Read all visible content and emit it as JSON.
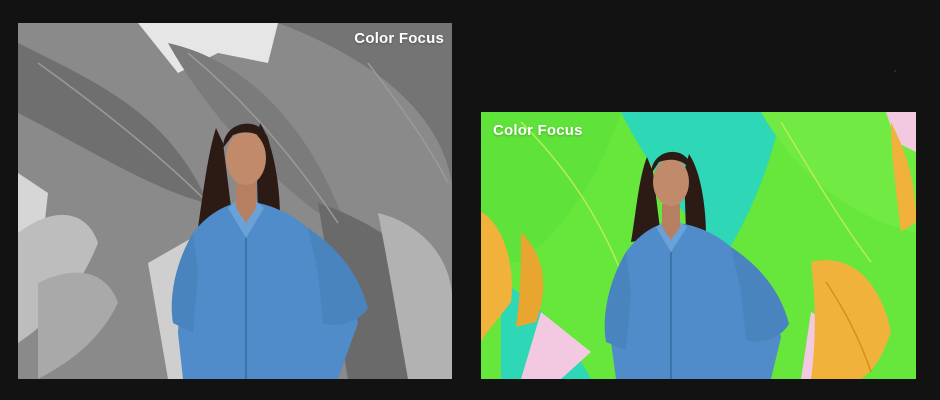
{
  "panels": {
    "left": {
      "label": "Color Focus",
      "mode": "grayscale background with colored subject",
      "colors": {
        "background_dark": "#7a7a7a",
        "background_light": "#d8d8d8",
        "shirt": "#4f8cc9",
        "skin": "#c08a6b",
        "hair": "#2b1b14"
      }
    },
    "right": {
      "label": "Color Focus",
      "mode": "full color",
      "colors": {
        "mural_green": "#67e63c",
        "mural_mint": "#2ed7b5",
        "mural_yellow": "#f0b23a",
        "mural_pink": "#f2c9e0",
        "shirt": "#4f8cc9",
        "skin": "#c08a6b",
        "hair": "#2b1b14"
      }
    }
  }
}
